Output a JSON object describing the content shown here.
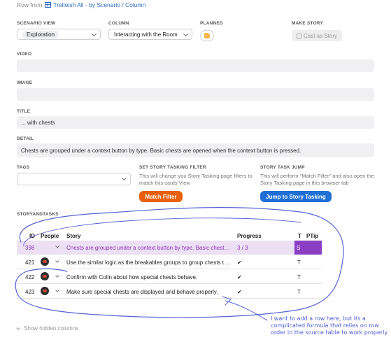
{
  "header": {
    "row_from_label": "Row from",
    "link_text": "Trelloish All - by Scenario / Column"
  },
  "fields": {
    "scenario_view": {
      "label": "SCENARIO VIEW",
      "value": "Exploration"
    },
    "column": {
      "label": "COLUMN",
      "value": "Interacting with the Room"
    },
    "planned": {
      "label": "PLANNED"
    },
    "make_story": {
      "label": "MAKE STORY",
      "button": "Cast as Story"
    },
    "video": {
      "label": "VIDEO",
      "value": ""
    },
    "image": {
      "label": "IMAGE",
      "value": ""
    },
    "title": {
      "label": "TITLE",
      "value": "... with chests"
    },
    "detail": {
      "label": "DETAIL",
      "value": "Chests are grouped under a context button by type.  Basic chests are opened when the context button is pressed."
    },
    "tags": {
      "label": "TAGS",
      "value": ""
    },
    "set_filter": {
      "label": "SET STORY TASKING FILTER",
      "hint": "This will change you Story Tasking page filters to match this cards View",
      "button": "Match Filter"
    },
    "task_jump": {
      "label": "STORY TASK JUMP",
      "hint": "This will perform \"Match Filter\" and also open the Story Tasking page in this browser tab",
      "button": "Jump to Story Tasking"
    }
  },
  "table": {
    "section_label": "STORYANDTASKS",
    "columns": [
      "ID",
      "People",
      "Story",
      "Progress",
      "T",
      "PTip"
    ],
    "rows": [
      {
        "id": "398",
        "story": "Chests are grouped under a context button by type. Basic chests are opened when the context button is pressed.",
        "progress": "3 / 3",
        "t": "S",
        "highlighted": true
      },
      {
        "id": "421",
        "story": "Use the similar logic as the breakables groups to group chests together.",
        "progress": "✔",
        "t": "T"
      },
      {
        "id": "422",
        "story": "Confirm with Colin about how special chests behave.",
        "progress": "✔",
        "t": "T"
      },
      {
        "id": "423",
        "story": "Make sure special chests are displayed and behave properly.",
        "progress": "✔",
        "t": "T"
      }
    ],
    "show_hidden": "Show hidden columns"
  },
  "annotation": "I want to add a row here, but its a complicated formula that relies on row order in the source table to work properly",
  "colors": {
    "accent_orange": "#e8600e",
    "accent_blue": "#1f6fd6",
    "highlight_purple": "#8a3fc3",
    "annotation_ink": "#4a59d3"
  }
}
